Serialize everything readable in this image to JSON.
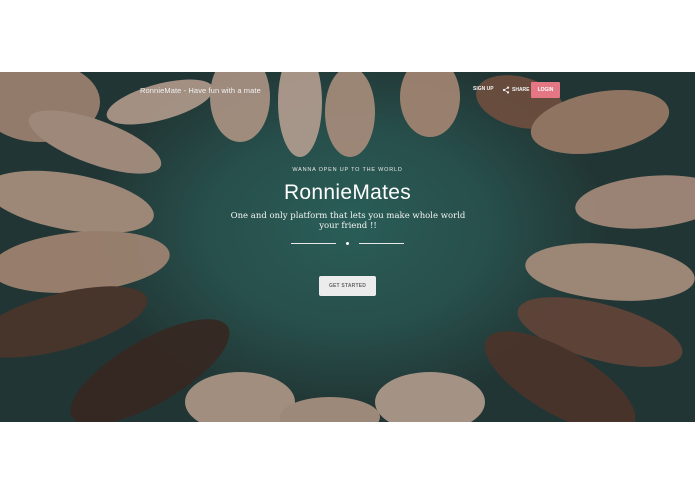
{
  "navbar": {
    "brand": "RonnieMate - Have fun with a mate",
    "signup_label": "SIGN UP",
    "share_label": "SHARE",
    "login_label": "LOGIN",
    "share_icon": "share-icon"
  },
  "hero": {
    "eyebrow": "WANNA OPEN UP TO THE WORLD",
    "title": "RonnieMates",
    "subtitle": "One and only platform that lets you make whole world your friend !!",
    "cta_label": "GET STARTED"
  },
  "colors": {
    "accent": "#e57684",
    "hero_teal": "#2f6f68",
    "cta_bg": "#ececec"
  }
}
